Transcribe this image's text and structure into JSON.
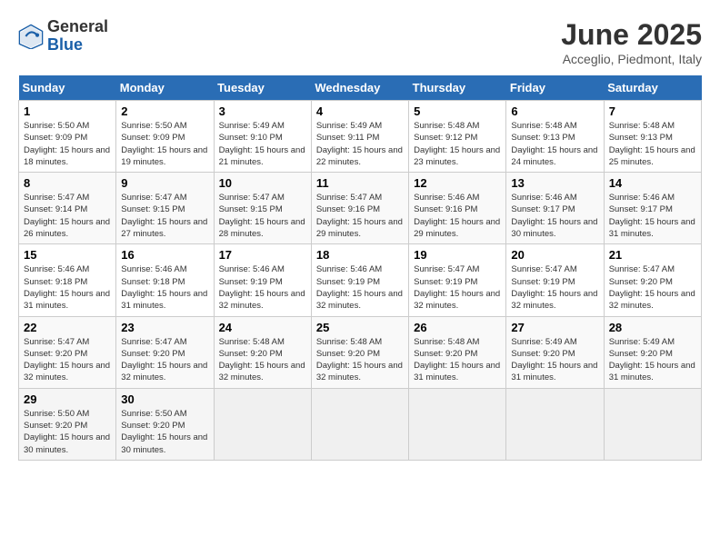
{
  "header": {
    "logo_general": "General",
    "logo_blue": "Blue",
    "title": "June 2025",
    "location": "Acceglio, Piedmont, Italy"
  },
  "weekdays": [
    "Sunday",
    "Monday",
    "Tuesday",
    "Wednesday",
    "Thursday",
    "Friday",
    "Saturday"
  ],
  "weeks": [
    [
      {
        "day": "1",
        "sunrise": "5:50 AM",
        "sunset": "9:09 PM",
        "daylight": "15 hours and 18 minutes."
      },
      {
        "day": "2",
        "sunrise": "5:50 AM",
        "sunset": "9:09 PM",
        "daylight": "15 hours and 19 minutes."
      },
      {
        "day": "3",
        "sunrise": "5:49 AM",
        "sunset": "9:10 PM",
        "daylight": "15 hours and 21 minutes."
      },
      {
        "day": "4",
        "sunrise": "5:49 AM",
        "sunset": "9:11 PM",
        "daylight": "15 hours and 22 minutes."
      },
      {
        "day": "5",
        "sunrise": "5:48 AM",
        "sunset": "9:12 PM",
        "daylight": "15 hours and 23 minutes."
      },
      {
        "day": "6",
        "sunrise": "5:48 AM",
        "sunset": "9:13 PM",
        "daylight": "15 hours and 24 minutes."
      },
      {
        "day": "7",
        "sunrise": "5:48 AM",
        "sunset": "9:13 PM",
        "daylight": "15 hours and 25 minutes."
      }
    ],
    [
      {
        "day": "8",
        "sunrise": "5:47 AM",
        "sunset": "9:14 PM",
        "daylight": "15 hours and 26 minutes."
      },
      {
        "day": "9",
        "sunrise": "5:47 AM",
        "sunset": "9:15 PM",
        "daylight": "15 hours and 27 minutes."
      },
      {
        "day": "10",
        "sunrise": "5:47 AM",
        "sunset": "9:15 PM",
        "daylight": "15 hours and 28 minutes."
      },
      {
        "day": "11",
        "sunrise": "5:47 AM",
        "sunset": "9:16 PM",
        "daylight": "15 hours and 29 minutes."
      },
      {
        "day": "12",
        "sunrise": "5:46 AM",
        "sunset": "9:16 PM",
        "daylight": "15 hours and 29 minutes."
      },
      {
        "day": "13",
        "sunrise": "5:46 AM",
        "sunset": "9:17 PM",
        "daylight": "15 hours and 30 minutes."
      },
      {
        "day": "14",
        "sunrise": "5:46 AM",
        "sunset": "9:17 PM",
        "daylight": "15 hours and 31 minutes."
      }
    ],
    [
      {
        "day": "15",
        "sunrise": "5:46 AM",
        "sunset": "9:18 PM",
        "daylight": "15 hours and 31 minutes."
      },
      {
        "day": "16",
        "sunrise": "5:46 AM",
        "sunset": "9:18 PM",
        "daylight": "15 hours and 31 minutes."
      },
      {
        "day": "17",
        "sunrise": "5:46 AM",
        "sunset": "9:19 PM",
        "daylight": "15 hours and 32 minutes."
      },
      {
        "day": "18",
        "sunrise": "5:46 AM",
        "sunset": "9:19 PM",
        "daylight": "15 hours and 32 minutes."
      },
      {
        "day": "19",
        "sunrise": "5:47 AM",
        "sunset": "9:19 PM",
        "daylight": "15 hours and 32 minutes."
      },
      {
        "day": "20",
        "sunrise": "5:47 AM",
        "sunset": "9:19 PM",
        "daylight": "15 hours and 32 minutes."
      },
      {
        "day": "21",
        "sunrise": "5:47 AM",
        "sunset": "9:20 PM",
        "daylight": "15 hours and 32 minutes."
      }
    ],
    [
      {
        "day": "22",
        "sunrise": "5:47 AM",
        "sunset": "9:20 PM",
        "daylight": "15 hours and 32 minutes."
      },
      {
        "day": "23",
        "sunrise": "5:47 AM",
        "sunset": "9:20 PM",
        "daylight": "15 hours and 32 minutes."
      },
      {
        "day": "24",
        "sunrise": "5:48 AM",
        "sunset": "9:20 PM",
        "daylight": "15 hours and 32 minutes."
      },
      {
        "day": "25",
        "sunrise": "5:48 AM",
        "sunset": "9:20 PM",
        "daylight": "15 hours and 32 minutes."
      },
      {
        "day": "26",
        "sunrise": "5:48 AM",
        "sunset": "9:20 PM",
        "daylight": "15 hours and 31 minutes."
      },
      {
        "day": "27",
        "sunrise": "5:49 AM",
        "sunset": "9:20 PM",
        "daylight": "15 hours and 31 minutes."
      },
      {
        "day": "28",
        "sunrise": "5:49 AM",
        "sunset": "9:20 PM",
        "daylight": "15 hours and 31 minutes."
      }
    ],
    [
      {
        "day": "29",
        "sunrise": "5:50 AM",
        "sunset": "9:20 PM",
        "daylight": "15 hours and 30 minutes."
      },
      {
        "day": "30",
        "sunrise": "5:50 AM",
        "sunset": "9:20 PM",
        "daylight": "15 hours and 30 minutes."
      },
      null,
      null,
      null,
      null,
      null
    ]
  ]
}
